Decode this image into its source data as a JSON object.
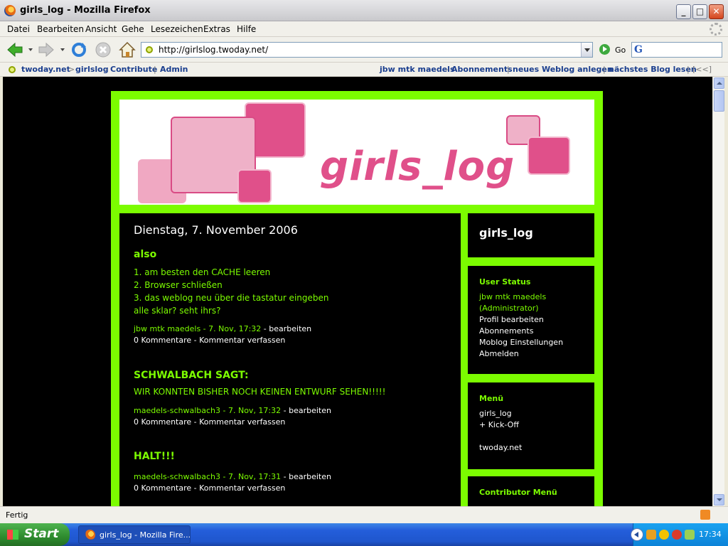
{
  "window": {
    "title": "girls_log - Mozilla Firefox"
  },
  "menu": {
    "items": [
      "Datei",
      "Bearbeiten",
      "Ansicht",
      "Gehe",
      "Lesezeichen",
      "Extras",
      "Hilfe"
    ]
  },
  "nav": {
    "url": "http://girlslog.twoday.net/",
    "go_label": "Go"
  },
  "bookmarks": {
    "site": "twoday.net",
    "crumb_sep": ">",
    "blog": "girlslog",
    "contribute": "Contribute",
    "admin": "Admin",
    "user": "jbw mtk maedels",
    "abonnements": "Abonnements",
    "new_weblog": "neues Weblog anlegen",
    "next_blog": "nächstes Blog lesen",
    "back_marker": "[<<]",
    "dash": "-",
    "pipe": "|"
  },
  "blog": {
    "logo_text": "girls_log",
    "date": "Dienstag, 7. November 2006",
    "posts": [
      {
        "title": "also",
        "lines": [
          "1. am besten den CACHE leeren",
          "2. Browser schließen",
          "3. das weblog neu über die tastatur eingeben",
          "alle sklar? seht ihrs?"
        ],
        "author_time": "jbw mtk maedels - 7. Nov, 17:32",
        "edit": " - bearbeiten",
        "comments": "0 Kommentare - Kommentar verfassen"
      },
      {
        "title": "SCHWALBACH SAGT:",
        "lines": [
          "WIR KONNTEN BISHER NOCH KEINEN ENTWURF SEHEN!!!!!"
        ],
        "author_time": "maedels-schwalbach3 - 7. Nov, 17:32",
        "edit": " - bearbeiten",
        "comments": "0 Kommentare - Kommentar verfassen"
      },
      {
        "title": "HALT!!!",
        "lines": [],
        "author_time": "maedels-schwalbach3 - 7. Nov, 17:31",
        "edit": " - bearbeiten",
        "comments": "0 Kommentare - Kommentar verfassen"
      }
    ],
    "sidebar": {
      "blog_title": "girls_log",
      "user_status": {
        "heading": "User Status",
        "user": "jbw mtk maedels",
        "role": "(Administrator)",
        "items": [
          "Profil bearbeiten",
          "Abonnements",
          "Moblog Einstellungen",
          "Abmelden"
        ]
      },
      "menu": {
        "heading": "Menü",
        "items": [
          "girls_log",
          "+ Kick-Off",
          "twoday.net"
        ]
      },
      "contributor": {
        "heading": "Contributor Menü"
      }
    }
  },
  "status": {
    "text": "Fertig"
  },
  "taskbar": {
    "start": "Start",
    "task": "girls_log - Mozilla Fire...",
    "clock": "17:34"
  },
  "colors": {
    "blog_green": "#7cfc00",
    "blog_pink": "#e0508a",
    "link_blue": "#1a3e8e"
  }
}
